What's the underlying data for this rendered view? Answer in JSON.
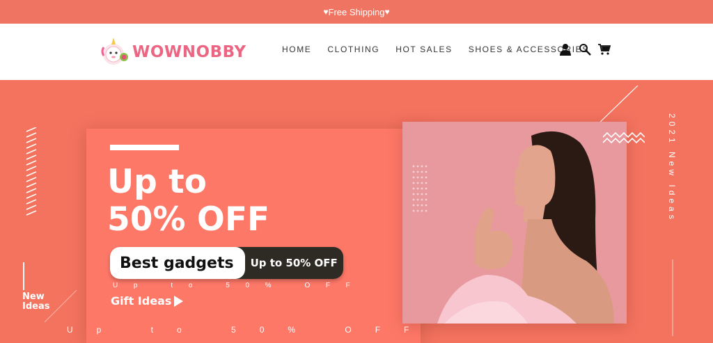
{
  "topbar": {
    "text": "Free Shipping",
    "heart": "♥"
  },
  "header": {
    "logo_text": "WOWNOBBY",
    "nav": [
      "HOME",
      "CLOTHING",
      "HOT SALES",
      "SHOES & ACCESSORIES"
    ],
    "icons": [
      "account-icon",
      "search-icon",
      "cart-icon"
    ]
  },
  "hero": {
    "headline_line1": "Up to",
    "headline_line2": "50% OFF",
    "pill_left": "Best gadgets",
    "pill_right": "Up to 50% OFF",
    "spaced_small": "Up to 50% OFF",
    "gift": "Gift Ideas",
    "new_ideas_1": "New",
    "new_ideas_2": "Ideas",
    "bottom_spaced": "Up to 50% OFF",
    "vertical_text": "2021 New Ideas"
  },
  "colors": {
    "topbar": "#f07462",
    "hero": "#f3735f",
    "card": "#fe7868",
    "logo": "#ec6582",
    "pill_dark": "#2d2b23",
    "photo_bg": "#e7979c"
  }
}
